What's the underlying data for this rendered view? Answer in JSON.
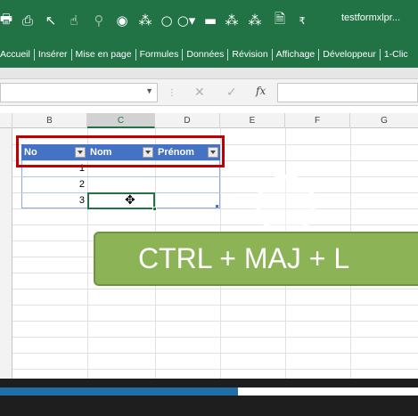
{
  "window": {
    "title": "testformxlpr..."
  },
  "quick_access": [
    "print-icon",
    "print-preview-icon",
    "select-arrow-icon",
    "pointer-icon",
    "filter-icon",
    "record-icon",
    "shapes-icon",
    "oval-icon",
    "circle-dropdown-icon",
    "save-icon",
    "group-icon",
    "ungroup-icon",
    "sheet-icon",
    "customize-icon"
  ],
  "ribbon_tabs": [
    "Accueil",
    "Insérer",
    "Mise en page",
    "Formules",
    "Données",
    "Révision",
    "Affichage",
    "Développeur",
    "1-Clic"
  ],
  "formula_bar": {
    "name_box": "",
    "cancel": "✕",
    "enter": "✓",
    "fx": "fx",
    "value": ""
  },
  "columns": [
    "B",
    "C",
    "D",
    "E",
    "F",
    "G"
  ],
  "selected_column": "C",
  "table": {
    "headers": [
      "No",
      "Nom",
      "Prénom"
    ],
    "rows": [
      {
        "no": "1",
        "nom": "",
        "prenom": ""
      },
      {
        "no": "2",
        "nom": "",
        "prenom": ""
      },
      {
        "no": "3",
        "nom": "",
        "prenom": ""
      }
    ]
  },
  "shortcut_label": "CTRL + MAJ + L",
  "video": {
    "progress": 0.57
  },
  "colors": {
    "excel_green": "#217346",
    "table_header": "#4472c4",
    "highlight_red": "#c00000",
    "shortcut_green": "#8cb356",
    "progress_blue": "#1f6fa8"
  }
}
